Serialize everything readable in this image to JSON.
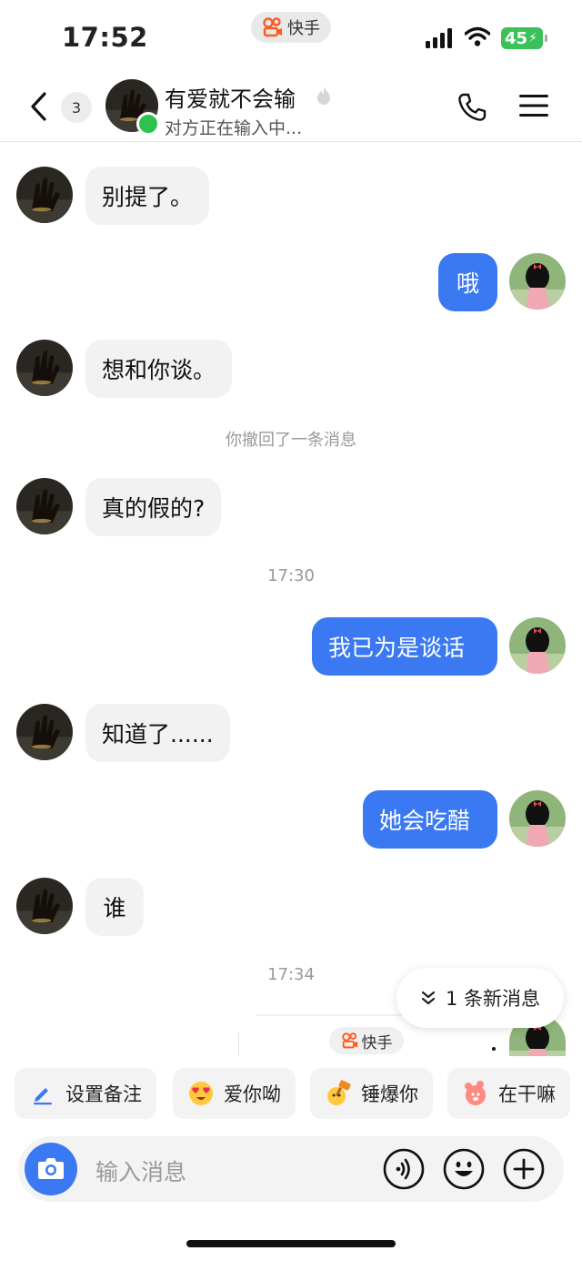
{
  "status_bar": {
    "time": "17:52",
    "app_pill": "快手",
    "battery": "45"
  },
  "header": {
    "unread_count": "3",
    "name": "有爱就不会输",
    "subtitle": "对方正在输入中..."
  },
  "messages": [
    {
      "side": "in",
      "text": "别提了。"
    },
    {
      "side": "out",
      "text": "哦"
    },
    {
      "side": "in",
      "text": "想和你谈。"
    },
    {
      "side": "system",
      "text": "你撤回了一条消息"
    },
    {
      "side": "in",
      "text": "真的假的?"
    },
    {
      "side": "time",
      "text": "17:30"
    },
    {
      "side": "out",
      "text": "我已为是谈话"
    },
    {
      "side": "in",
      "text": "知道了......"
    },
    {
      "side": "out",
      "text": "她会吃醋"
    },
    {
      "side": "in",
      "text": "谁"
    },
    {
      "side": "time",
      "text": "17:34"
    }
  ],
  "partial_card": {
    "label": "快手"
  },
  "new_messages_pill": "1 条新消息",
  "quick_chips": [
    {
      "label": "设置备注",
      "icon": "pencil-icon"
    },
    {
      "label": "爱你呦",
      "icon": "heart-eyes-emoji-icon"
    },
    {
      "label": "锤爆你",
      "icon": "hammer-emoji-icon"
    },
    {
      "label": "在干嘛",
      "icon": "bear-emoji-icon"
    }
  ],
  "input": {
    "placeholder": "输入消息"
  },
  "colors": {
    "accent": "#3b79f2",
    "incoming_bubble": "#f2f2f3",
    "online": "#2ec14f",
    "battery": "#3cc05a"
  }
}
